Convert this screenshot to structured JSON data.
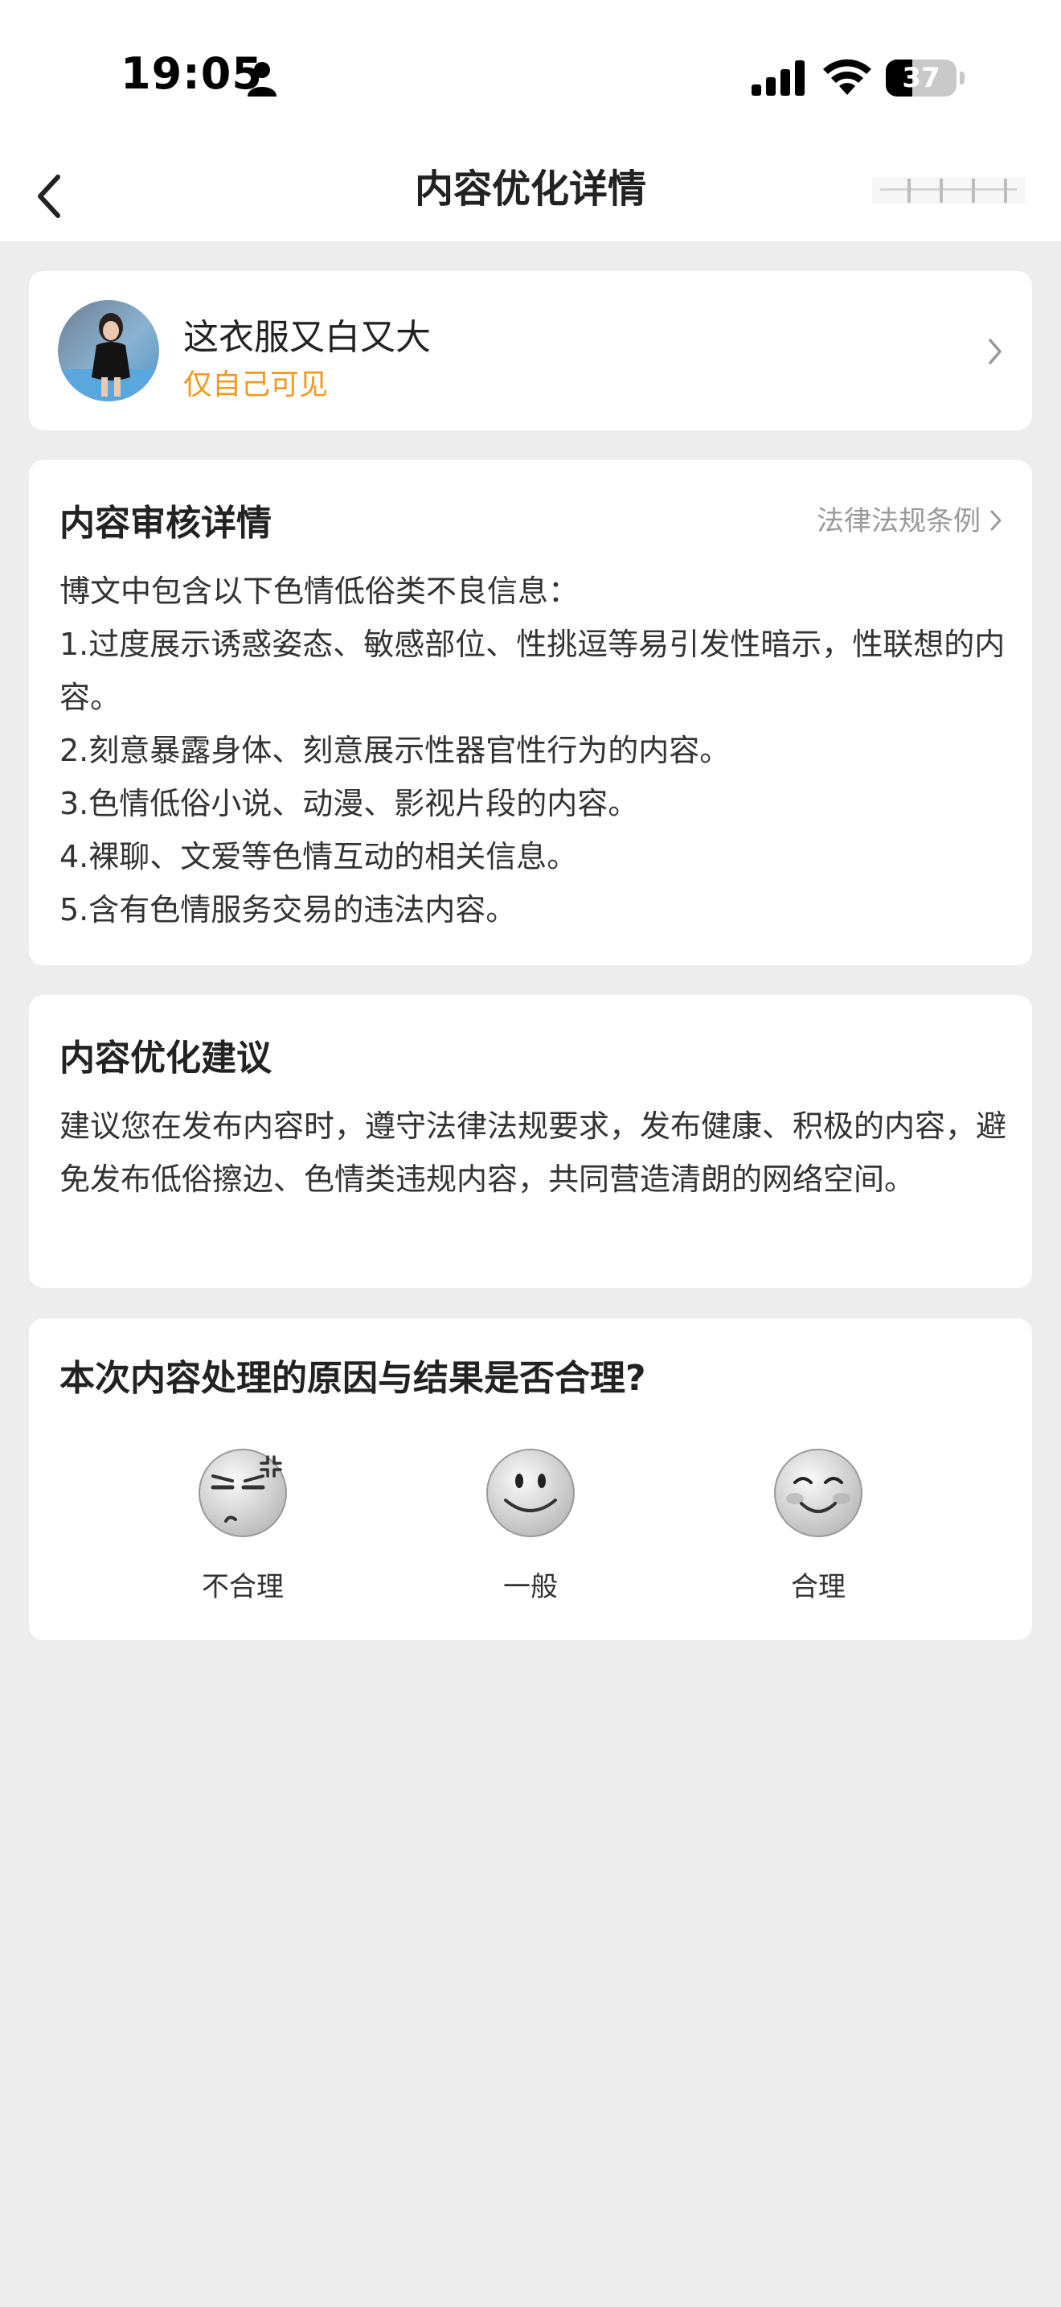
{
  "status_bar": {
    "time": "19:05",
    "battery_percent": 37,
    "battery_label": "37"
  },
  "header": {
    "title": "内容优化详情"
  },
  "post": {
    "title": "这衣服又白又大",
    "visibility": "仅自己可见"
  },
  "review": {
    "title": "内容审核详情",
    "law_link_label": "法律法规条例",
    "intro": "博文中包含以下色情低俗类不良信息：",
    "items": [
      "1.过度展示诱惑姿态、敏感部位、性挑逗等易引发性暗示，性联想的内容。",
      "2.刻意暴露身体、刻意展示性器官性行为的内容。",
      "3.色情低俗小说、动漫、影视片段的内容。",
      "4.裸聊、文爱等色情互动的相关信息。",
      "5.含有色情服务交易的违法内容。"
    ]
  },
  "advice": {
    "title": "内容优化建议",
    "text": "建议您在发布内容时，遵守法律法规要求，发布健康、积极的内容，避免发布低俗擦边、色情类违规内容，共同营造清朗的网络空间。"
  },
  "feedback": {
    "question": "本次内容处理的原因与结果是否合理?",
    "options": [
      {
        "label": "不合理",
        "icon": "annoyed-face-icon"
      },
      {
        "label": "一般",
        "icon": "neutral-smile-face-icon"
      },
      {
        "label": "合理",
        "icon": "happy-face-icon"
      }
    ]
  }
}
